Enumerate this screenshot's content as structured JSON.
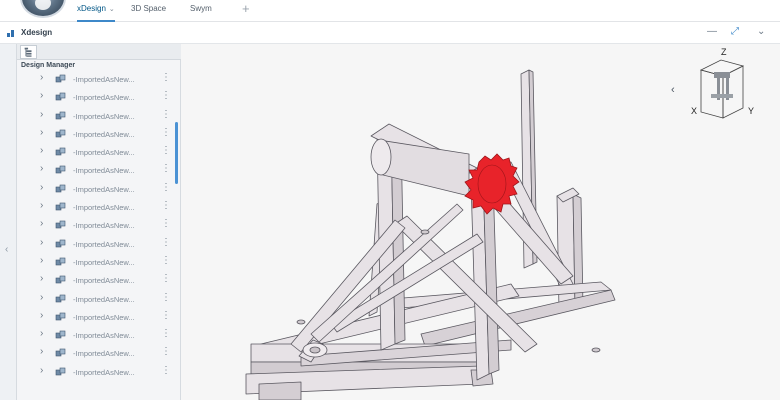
{
  "top_tabs": [
    {
      "label": "xDesign",
      "active": true
    },
    {
      "label": "3D Space",
      "active": false
    },
    {
      "label": "Swym",
      "active": false
    }
  ],
  "add_tab_symbol": "+",
  "app": {
    "title": "Xdesign"
  },
  "window_controls": {
    "minimize": "—",
    "collapse": "⤢",
    "menu": "⌄"
  },
  "panel": {
    "title": "Design Manager",
    "rows": [
      {
        "label": "-ImportedAsNew..."
      },
      {
        "label": "-ImportedAsNew..."
      },
      {
        "label": "-ImportedAsNew..."
      },
      {
        "label": "-ImportedAsNew..."
      },
      {
        "label": "-ImportedAsNew..."
      },
      {
        "label": "-ImportedAsNew..."
      },
      {
        "label": "-ImportedAsNew..."
      },
      {
        "label": "-ImportedAsNew..."
      },
      {
        "label": "-ImportedAsNew..."
      },
      {
        "label": "-ImportedAsNew..."
      },
      {
        "label": "-ImportedAsNew..."
      },
      {
        "label": "-ImportedAsNew..."
      },
      {
        "label": "-ImportedAsNew..."
      },
      {
        "label": "-ImportedAsNew..."
      },
      {
        "label": "-ImportedAsNew..."
      },
      {
        "label": "-ImportedAsNew..."
      },
      {
        "label": "-ImportedAsNew..."
      }
    ]
  },
  "nav_cube": {
    "x": "X",
    "y": "Y",
    "z": "Z"
  },
  "colors": {
    "accent": "#3d88c9",
    "highlight": "#e8232a",
    "part": "#e6e1e5"
  },
  "icons": {
    "tree": "tree-icon",
    "chevron": "chevron-right-icon",
    "more": "more-vertical-icon",
    "part": "part-icon"
  }
}
